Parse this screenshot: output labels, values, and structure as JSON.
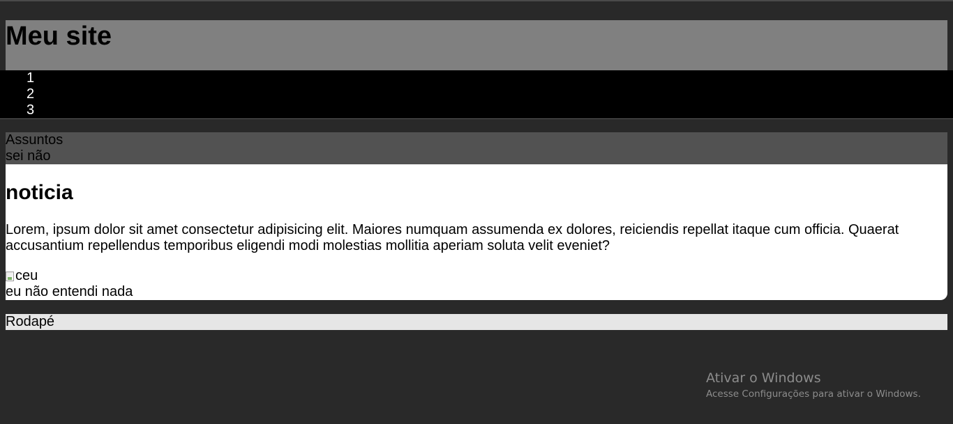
{
  "header": {
    "title": "Meu site"
  },
  "nav": {
    "items": [
      "1",
      "2",
      "3"
    ]
  },
  "aside": {
    "heading": "Assuntos",
    "text": "sei não"
  },
  "article": {
    "title": "noticia",
    "body": "Lorem, ipsum dolor sit amet consectetur adipisicing elit. Maiores numquam assumenda ex dolores, reiciendis repellat itaque cum officia. Quaerat accusantium repellendus temporibus eligendi modi molestias mollitia aperiam soluta velit eveniet?",
    "image_alt": "ceu",
    "caption": "eu não entendi nada"
  },
  "footer": {
    "text": "Rodapé"
  },
  "watermark": {
    "title": "Ativar o Windows",
    "subtitle": "Acesse Configurações para ativar o Windows."
  },
  "colors": {
    "page_background": "#292929",
    "header_background": "#808080",
    "nav_background": "#000000",
    "aside_background": "#525252",
    "article_background": "#ffffff",
    "footer_background": "#e6e6e6"
  }
}
